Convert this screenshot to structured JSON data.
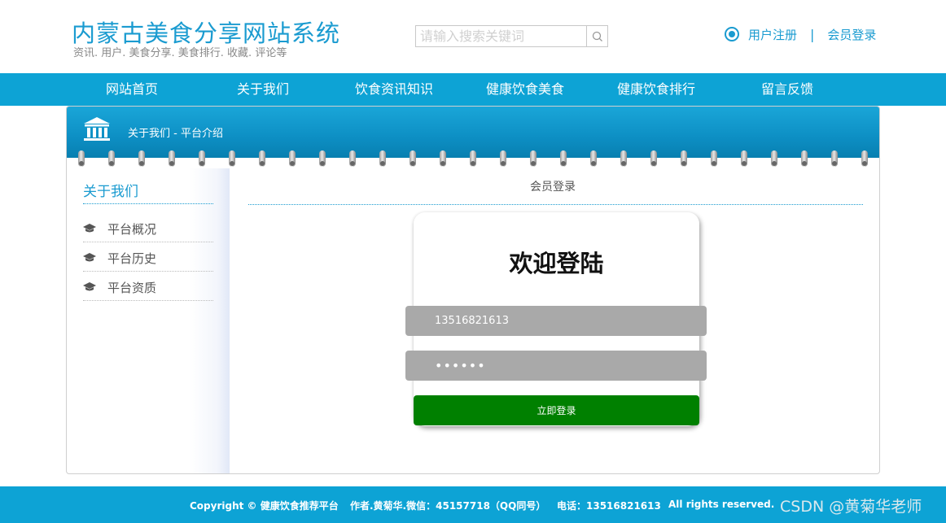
{
  "header": {
    "title": "内蒙古美食分享网站系统",
    "subtitle": "资讯. 用户. 美食分享. 美食排行. 收藏. 评论等",
    "search_placeholder": "请输入搜索关键词",
    "search_icon": "search-icon",
    "register_icon": "radio-circle-icon",
    "register_label": "用户注册",
    "separator": "|",
    "login_label": "会员登录"
  },
  "nav": {
    "items": [
      "网站首页",
      "关于我们",
      "饮食资讯知识",
      "健康饮食美食",
      "健康饮食排行",
      "留言反馈"
    ]
  },
  "panel": {
    "icon": "bank-building-icon",
    "title": "关于我们 - 平台介绍"
  },
  "sidebar": {
    "title": "关于我们",
    "item_icon": "graduation-cap-icon",
    "items": [
      {
        "label": "平台概况"
      },
      {
        "label": "平台历史"
      },
      {
        "label": "平台资质"
      }
    ]
  },
  "main": {
    "title": "会员登录"
  },
  "login": {
    "heading": "欢迎登陆",
    "username_value": "13516821613",
    "password_value": "••••••",
    "submit_label": "立即登录",
    "submit_color": "#008000"
  },
  "footer": {
    "copyright": "Copyright © 健康饮食推荐平台",
    "author": "作者.黄菊华.微信：45157718（QQ同号）",
    "phone": "电话：13516821613",
    "rights": "All rights reserved.",
    "watermark": "CSDN @黄菊华老师"
  },
  "colors": {
    "brand": "#1a9bd0",
    "nav_bg": "#0da3d5",
    "input_bg": "#a9a9a9"
  }
}
